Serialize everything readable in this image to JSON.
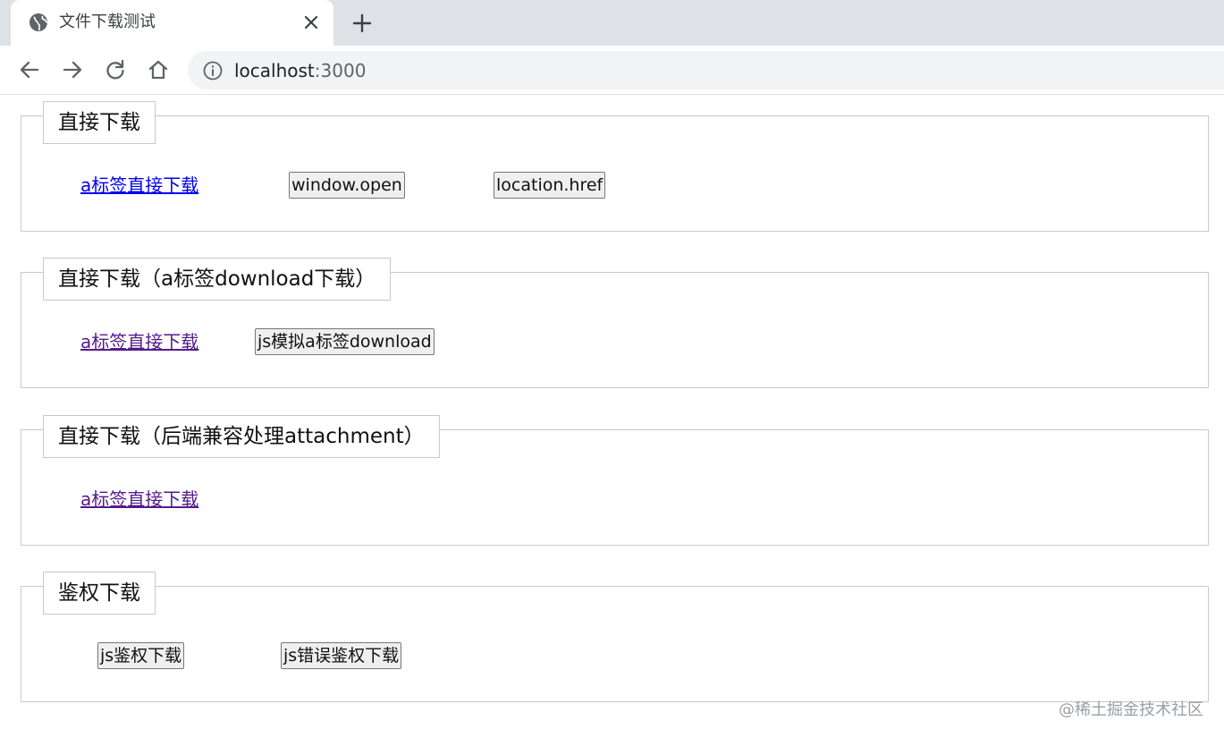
{
  "browser": {
    "tab_title": "文件下载测试",
    "url_host": "localhost",
    "url_port": ":3000"
  },
  "sections": [
    {
      "legend": "直接下载",
      "link_label": "a标签直接下载",
      "buttons": [
        "window.open",
        "location.href"
      ]
    },
    {
      "legend": "直接下载（a标签download下载）",
      "link_label": "a标签直接下载",
      "buttons": [
        "js模拟a标签download"
      ]
    },
    {
      "legend": "直接下载（后端兼容处理attachment）",
      "link_label": "a标签直接下载"
    },
    {
      "legend": "鉴权下载",
      "buttons": [
        "js鉴权下载",
        "js错误鉴权下载"
      ]
    }
  ],
  "watermark": "@稀土掘金技术社区",
  "colors": {
    "link_unvisited": "#0000ee",
    "link_visited": "#551a8b",
    "chrome_background": "#dee1e6",
    "omnibox_background": "#f1f3f4"
  },
  "icons": [
    "globe-icon",
    "close-icon",
    "plus-icon",
    "back-arrow-icon",
    "forward-arrow-icon",
    "reload-icon",
    "home-icon",
    "info-icon"
  ]
}
